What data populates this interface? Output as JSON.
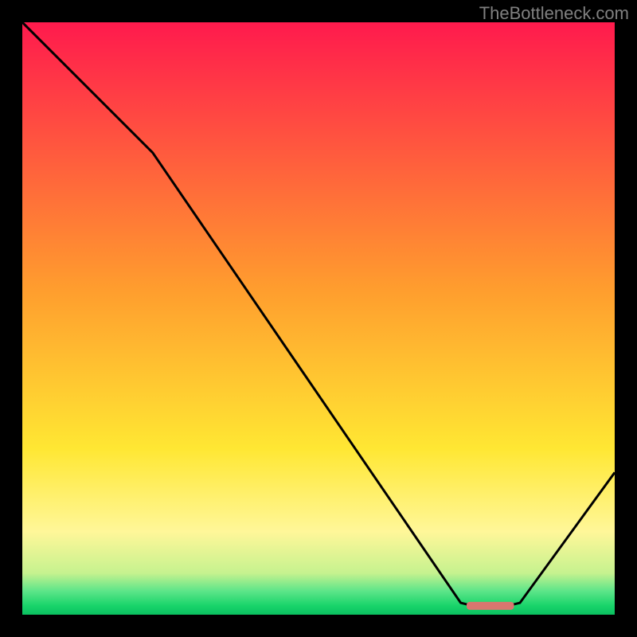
{
  "watermark": "TheBottleneck.com",
  "chart_data": {
    "type": "line",
    "title": "",
    "xlabel": "",
    "ylabel": "",
    "xlim": [
      0,
      100
    ],
    "ylim": [
      0,
      100
    ],
    "series": [
      {
        "name": "curve",
        "points": [
          {
            "x": 0,
            "y": 100
          },
          {
            "x": 22,
            "y": 78
          },
          {
            "x": 74,
            "y": 2
          },
          {
            "x": 76,
            "y": 1.5
          },
          {
            "x": 82,
            "y": 1.5
          },
          {
            "x": 84,
            "y": 2
          },
          {
            "x": 100,
            "y": 24
          }
        ]
      }
    ],
    "marker": {
      "x_start": 75,
      "x_end": 83,
      "y": 1.5,
      "color": "#d9766f"
    },
    "gradient_bands": [
      {
        "y_pct": 0,
        "color": "#ff1a4d"
      },
      {
        "y_pct": 45,
        "color": "#ff9d2e"
      },
      {
        "y_pct": 72,
        "color": "#ffe733"
      },
      {
        "y_pct": 86,
        "color": "#fff799"
      },
      {
        "y_pct": 93,
        "color": "#c6f28f"
      },
      {
        "y_pct": 96,
        "color": "#5de589"
      },
      {
        "y_pct": 98.5,
        "color": "#18d46a"
      },
      {
        "y_pct": 100,
        "color": "#0bc060"
      }
    ]
  }
}
